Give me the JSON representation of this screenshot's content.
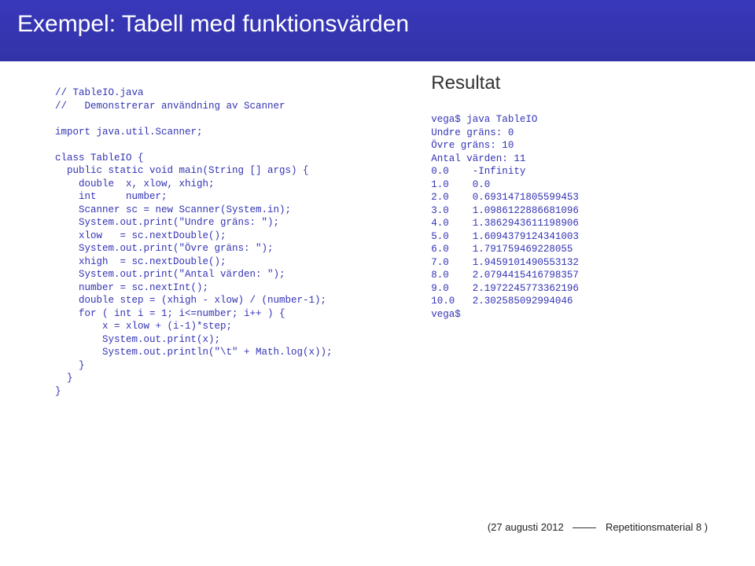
{
  "header": {
    "title": "Exempel: Tabell med funktionsvärden"
  },
  "code": {
    "left": "// TableIO.java\n//   Demonstrerar användning av Scanner\n\nimport java.util.Scanner;\n\nclass TableIO {\n  public static void main(String [] args) {\n    double  x, xlow, xhigh;\n    int     number;\n    Scanner sc = new Scanner(System.in);\n    System.out.print(\"Undre gräns: \");\n    xlow   = sc.nextDouble();\n    System.out.print(\"Övre gräns: \");\n    xhigh  = sc.nextDouble();\n    System.out.print(\"Antal värden: \");\n    number = sc.nextInt();\n    double step = (xhigh - xlow) / (number-1);\n    for ( int i = 1; i<=number; i++ ) {\n        x = xlow + (i-1)*step;\n        System.out.print(x);\n        System.out.println(\"\\t\" + Math.log(x));\n    }\n  }\n}"
  },
  "result": {
    "title": "Resultat",
    "output": "vega$ java TableIO\nUndre gräns: 0\nÖvre gräns: 10\nAntal värden: 11\n0.0    -Infinity\n1.0    0.0\n2.0    0.6931471805599453\n3.0    1.0986122886681096\n4.0    1.3862943611198906\n5.0    1.6094379124341003\n6.0    1.791759469228055\n7.0    1.9459101490553132\n8.0    2.0794415416798357\n9.0    2.1972245773362196\n10.0   2.302585092994046\nvega$"
  },
  "footer": {
    "date": "(27 augusti 2012",
    "label": "Repetitionsmaterial 8 )"
  }
}
